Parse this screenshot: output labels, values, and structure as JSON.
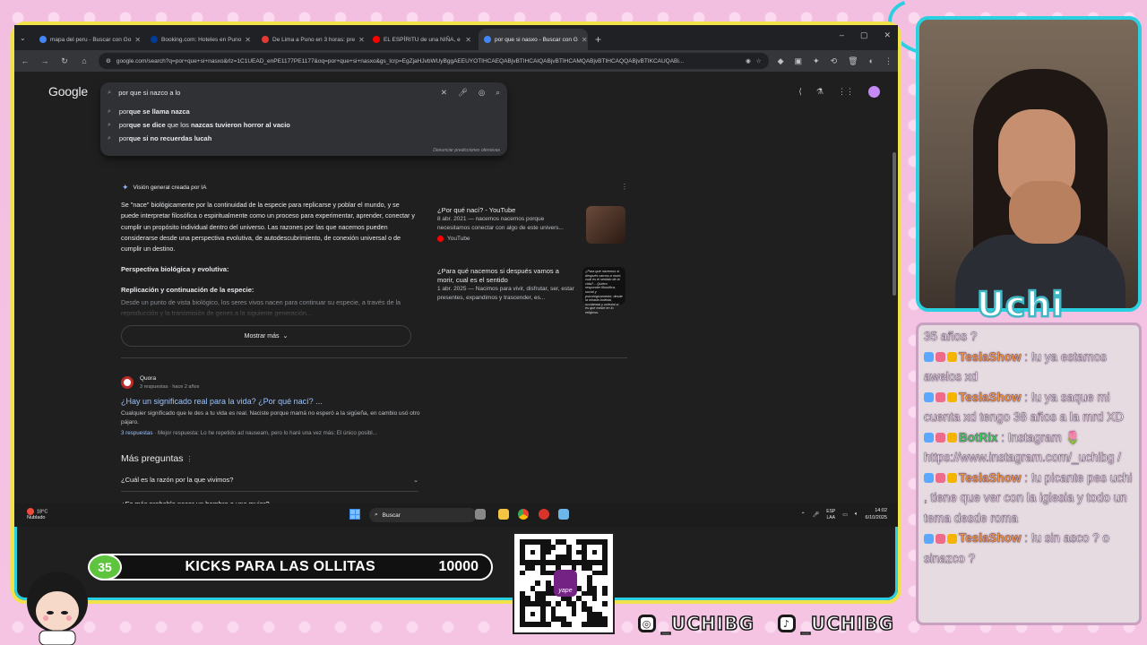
{
  "browser": {
    "tabs": [
      {
        "label": "mapa del peru - Buscar con Go",
        "favicon_color": "#4285f4",
        "active": false
      },
      {
        "label": "Booking.com: Hoteles en Puno",
        "favicon_color": "#003b95",
        "active": false
      },
      {
        "label": "De Lima a Puno en 3 horas: pre",
        "favicon_color": "#e53935",
        "active": false
      },
      {
        "label": "EL ESPÍRITU de una NIÑA, e",
        "favicon_color": "#ff0000",
        "active": false
      },
      {
        "label": "por que si nasxo - Buscar con G",
        "favicon_color": "#4285f4",
        "active": true
      }
    ],
    "url": "google.com/search?q=por+que+si+nasxo&rlz=1C1UEAD_enPE1177PE1177&oq=por+que+si+nasxo&gs_lcrp=EgZjaHJvbWUyBggAEEUYOTIHCAEQABjvBTIHCAIQABjvBTIHCAMQABjvBTIHCAQQABjvBTIKCAUQABi..."
  },
  "google": {
    "logo": "Google",
    "query": "por que si nazco a lo",
    "suggestions": [
      {
        "prefix": "por",
        "bold": "que se llama nazca",
        "rest": ""
      },
      {
        "prefix": "por",
        "bold": "que se dice",
        "rest": " que los ",
        "bold2": "nazcas tuvieron horror al vacio"
      },
      {
        "prefix": "por",
        "bold": "que si no recuerdas lucah",
        "rest": ""
      }
    ],
    "report_link": "Denunciar predicciones ofensivas",
    "ai_overview": {
      "header": "Visión general creada por IA",
      "paragraph": "Se \"nace\" biológicamente por la continuidad de la especie para replicarse y poblar el mundo, y se puede interpretar filosófica o espiritualmente como un proceso para experimentar, aprender, conectar y cumplir un propósito individual dentro del universo. Las razones por las que nacemos pueden considerarse desde una perspectiva evolutiva, de autodescubrimiento, de conexión universal o de cumplir un destino.",
      "subheading1": "Perspectiva biológica y evolutiva:",
      "subheading2": "Replicación y continuación de la especie:",
      "faded": "Desde un punto de vista biológico, los seres vivos nacen para continuar su especie, a través de la reproducción y la transmisión de genes a la siguiente generación...",
      "more_button": "Mostrar más"
    },
    "videos": [
      {
        "title": "¿Por qué nací? - YouTube",
        "meta": "8 abr. 2021 — nacemos nacemos porque necesitamos conectar con algo de este univers...",
        "source": "YouTube"
      },
      {
        "title": "¿Para qué nacemos si después vamos a morir, cual es el sentido",
        "meta": "1 abr. 2025 — Nacimos para vivir, disfrutar, ser, estar presentes, expandimos y trascender, es...",
        "thumb_text": "¿Para qué nacemos si después vamos a morir, cuál es el sentido de la vida?... Quiero responder filosófica, social y psicológicamente, desde la mirada budista, occidental y oriental si es que existe en lo religioso."
      }
    ],
    "quora": {
      "source": "Quora",
      "meta": "3 respuestas · hace 2 años",
      "title": "¿Hay un significado real para la vida? ¿Por qué nací? ...",
      "desc": "Cualquier significado que le des a tu vida es real. Naciste porque mamá no esperó a la sigüeña, en cambio usó otro pájaro.",
      "answers_link": "3 respuestas",
      "best_answer": "Mejor respuesta: Lo he repetido ad nauseam, pero lo haré una vez más: El único posibl..."
    },
    "paa": {
      "heading": "Más preguntas",
      "items": [
        "¿Cuál es la razón por la que vivimos?",
        "¿Es más probable nacer un hombre o una mujer?"
      ]
    }
  },
  "taskbar": {
    "weather_temp": "18°C",
    "weather_desc": "Nublado",
    "search_label": "Buscar",
    "lang1": "ESP",
    "lang2": "LAA",
    "time": "14:02",
    "date": "6/10/2025"
  },
  "goal": {
    "count": "35",
    "title": "KICKS PARA LAS OLLITAS",
    "target": "10000"
  },
  "qr": {
    "logo_text": "yape"
  },
  "socials": {
    "instagram": "_UCHIBG",
    "tiktok": "_UCHIBG"
  },
  "streamer": {
    "name": "Uchi"
  },
  "chat": [
    {
      "user": "",
      "text": "35 años ?",
      "color": "#ffffff"
    },
    {
      "user": "TeslaShow",
      "text": ": !u ya estamos awelos xd",
      "color": "#ff9a3c"
    },
    {
      "user": "TeslaShow",
      "text": ": !u ya saque mi cuenta xd tengo 38 años a la mrd XD",
      "color": "#ff9a3c"
    },
    {
      "user": "BotRix",
      "text": ": Instagram 🌷 https://www.instagram.com/_uchibg /",
      "color": "#34d85a"
    },
    {
      "user": "TeslaShow",
      "text": ": !u picante pes uchi , tiene que ver con la iglesia y todo un tema desde roma",
      "color": "#ff9a3c"
    },
    {
      "user": "TeslaShow",
      "text": ": !u sin asco ? o sinazco ?",
      "color": "#ff9a3c"
    }
  ]
}
